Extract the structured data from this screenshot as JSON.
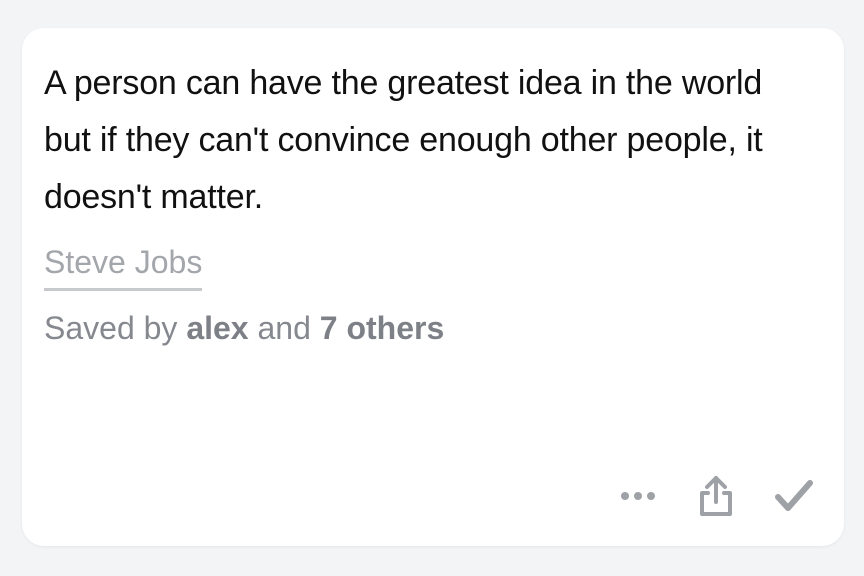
{
  "quote": {
    "text": "A person can have the greatest idea in the world but if they can't convince enough other people, it doesn't matter.",
    "author": "Steve Jobs"
  },
  "saved": {
    "prefix": "Saved by",
    "user": "alex",
    "conjunction": "and",
    "others": "7 others"
  },
  "actions": [
    {
      "name": "more",
      "icon": "ellipsis-icon"
    },
    {
      "name": "share",
      "icon": "share-icon"
    },
    {
      "name": "save",
      "icon": "checkmark-icon"
    }
  ],
  "colors": {
    "background": "#f3f4f6",
    "card": "#ffffff",
    "quote_text": "#111111",
    "muted_text": "#85888e",
    "icon": "#9ea1a6"
  }
}
